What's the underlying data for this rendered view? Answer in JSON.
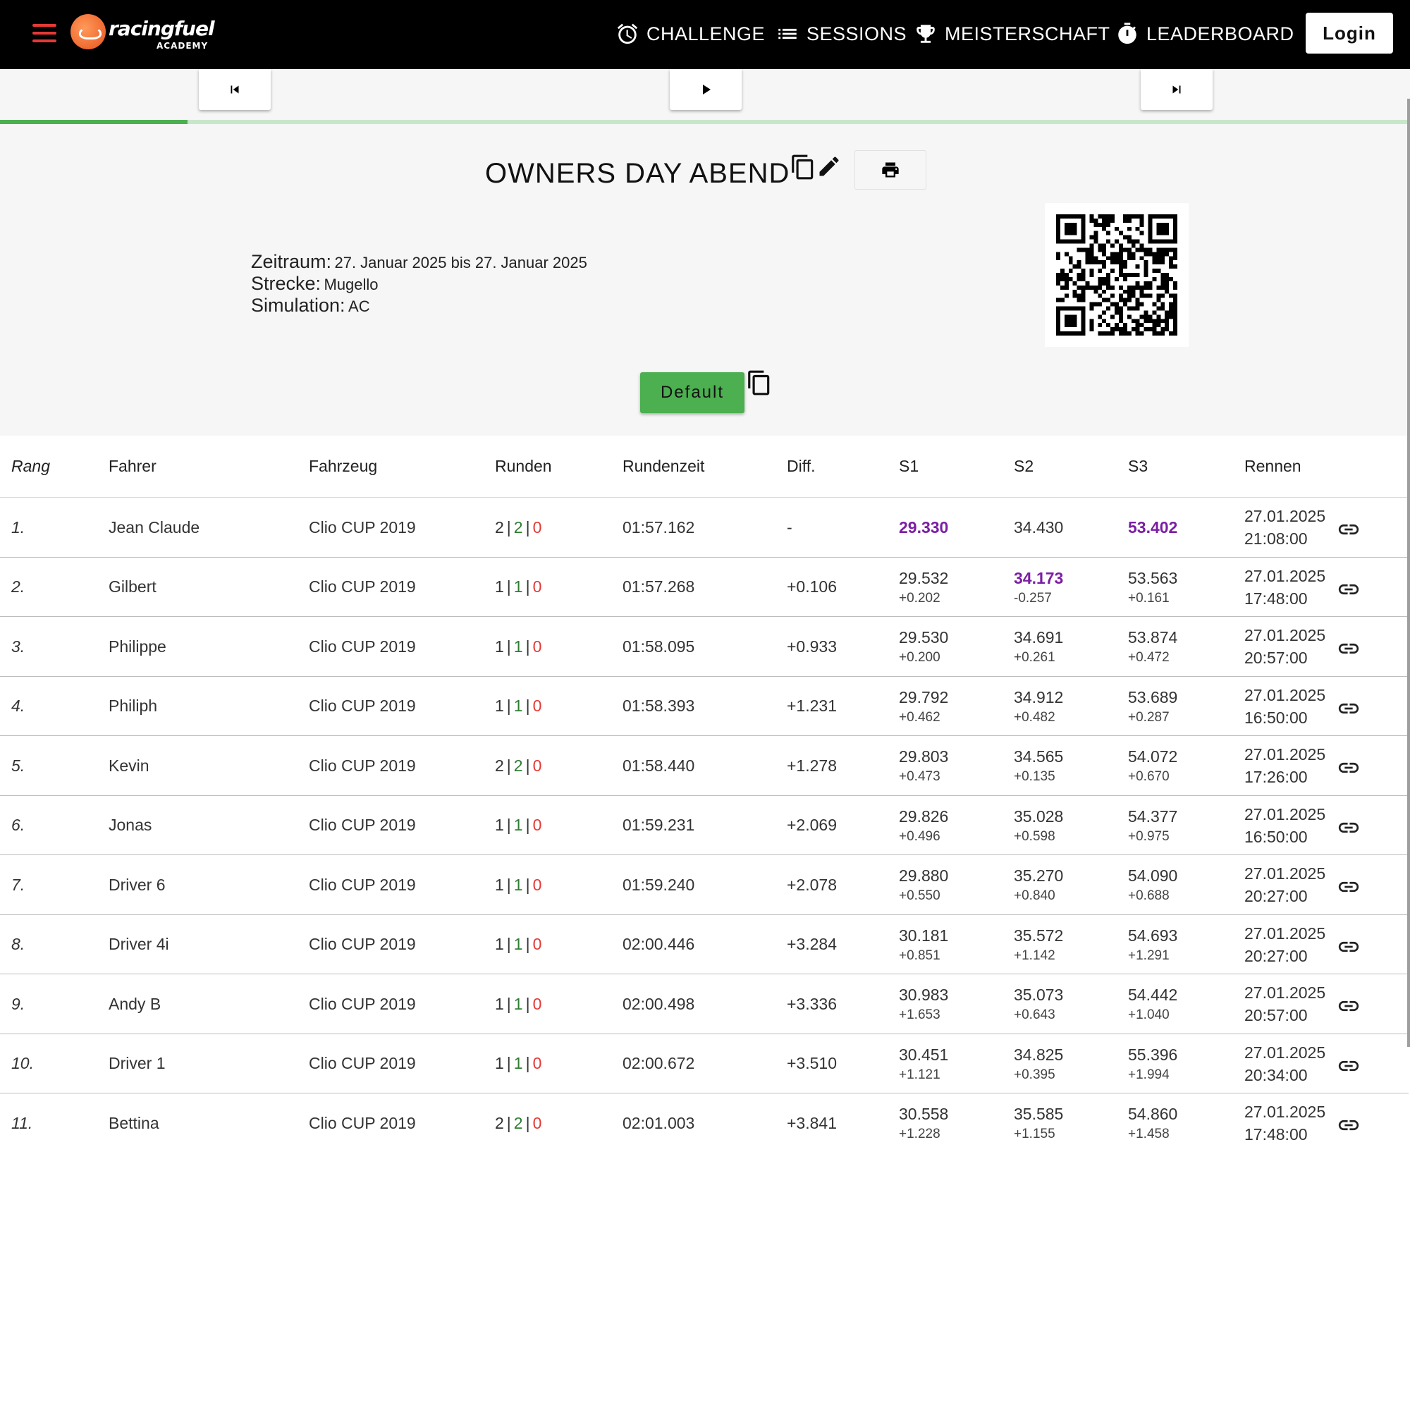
{
  "nav": {
    "brand": "racingfuel",
    "brand_sub": "ACADEMY",
    "items": [
      {
        "label": "CHALLENGE",
        "icon": "alarm-clock-icon"
      },
      {
        "label": "SESSIONS",
        "icon": "list-icon"
      },
      {
        "label": "MEISTERSCHAFT",
        "icon": "trophy-icon"
      },
      {
        "label": "LEADERBOARD",
        "icon": "stopwatch-icon"
      }
    ],
    "login_label": "Login"
  },
  "player": {
    "progress": 0.133,
    "buttons": [
      "skip-previous-icon",
      "play-icon",
      "skip-next-icon"
    ]
  },
  "event": {
    "title": "OWNERS DAY ABEND",
    "zeitraum_label": "Zeitraum:",
    "zeitraum_value": "27. Januar 2025 bis 27. Januar 2025",
    "strecke_label": "Strecke:",
    "strecke_value": "Mugello",
    "simulation_label": "Simulation:",
    "simulation_value": "AC",
    "default_label": "Default"
  },
  "colors": {
    "accent_green": "#4caf50",
    "best_purple": "#7b1fa2",
    "lap_green": "#2e7d32",
    "lap_red": "#e53935",
    "menu_red": "#e53935"
  },
  "table": {
    "headers": {
      "rang": "Rang",
      "fahrer": "Fahrer",
      "fahrzeug": "Fahrzeug",
      "runden": "Runden",
      "rundenzeit": "Rundenzeit",
      "diff": "Diff.",
      "s1": "S1",
      "s2": "S2",
      "s3": "S3",
      "rennen": "Rennen"
    },
    "rows": [
      {
        "rang": "1.",
        "fahrer": "Jean Claude",
        "fahrzeug": "Clio CUP 2019",
        "laps": [
          "2",
          "2",
          "0"
        ],
        "zeit": "01:57.162",
        "diff": "-",
        "s1": "29.330",
        "s1d": "",
        "s1best": true,
        "s2": "34.430",
        "s2d": "",
        "s2best": false,
        "s3": "53.402",
        "s3d": "",
        "s3best": true,
        "datum": "27.01.2025",
        "uhrzeit": "21:08:00"
      },
      {
        "rang": "2.",
        "fahrer": "Gilbert",
        "fahrzeug": "Clio CUP 2019",
        "laps": [
          "1",
          "1",
          "0"
        ],
        "zeit": "01:57.268",
        "diff": "+0.106",
        "s1": "29.532",
        "s1d": "+0.202",
        "s1best": false,
        "s2": "34.173",
        "s2d": "-0.257",
        "s2best": true,
        "s3": "53.563",
        "s3d": "+0.161",
        "s3best": false,
        "datum": "27.01.2025",
        "uhrzeit": "17:48:00"
      },
      {
        "rang": "3.",
        "fahrer": "Philippe",
        "fahrzeug": "Clio CUP 2019",
        "laps": [
          "1",
          "1",
          "0"
        ],
        "zeit": "01:58.095",
        "diff": "+0.933",
        "s1": "29.530",
        "s1d": "+0.200",
        "s1best": false,
        "s2": "34.691",
        "s2d": "+0.261",
        "s2best": false,
        "s3": "53.874",
        "s3d": "+0.472",
        "s3best": false,
        "datum": "27.01.2025",
        "uhrzeit": "20:57:00"
      },
      {
        "rang": "4.",
        "fahrer": "Philiph",
        "fahrzeug": "Clio CUP 2019",
        "laps": [
          "1",
          "1",
          "0"
        ],
        "zeit": "01:58.393",
        "diff": "+1.231",
        "s1": "29.792",
        "s1d": "+0.462",
        "s1best": false,
        "s2": "34.912",
        "s2d": "+0.482",
        "s2best": false,
        "s3": "53.689",
        "s3d": "+0.287",
        "s3best": false,
        "datum": "27.01.2025",
        "uhrzeit": "16:50:00"
      },
      {
        "rang": "5.",
        "fahrer": "Kevin",
        "fahrzeug": "Clio CUP 2019",
        "laps": [
          "2",
          "2",
          "0"
        ],
        "zeit": "01:58.440",
        "diff": "+1.278",
        "s1": "29.803",
        "s1d": "+0.473",
        "s1best": false,
        "s2": "34.565",
        "s2d": "+0.135",
        "s2best": false,
        "s3": "54.072",
        "s3d": "+0.670",
        "s3best": false,
        "datum": "27.01.2025",
        "uhrzeit": "17:26:00"
      },
      {
        "rang": "6.",
        "fahrer": "Jonas",
        "fahrzeug": "Clio CUP 2019",
        "laps": [
          "1",
          "1",
          "0"
        ],
        "zeit": "01:59.231",
        "diff": "+2.069",
        "s1": "29.826",
        "s1d": "+0.496",
        "s1best": false,
        "s2": "35.028",
        "s2d": "+0.598",
        "s2best": false,
        "s3": "54.377",
        "s3d": "+0.975",
        "s3best": false,
        "datum": "27.01.2025",
        "uhrzeit": "16:50:00"
      },
      {
        "rang": "7.",
        "fahrer": "Driver 6",
        "fahrzeug": "Clio CUP 2019",
        "laps": [
          "1",
          "1",
          "0"
        ],
        "zeit": "01:59.240",
        "diff": "+2.078",
        "s1": "29.880",
        "s1d": "+0.550",
        "s1best": false,
        "s2": "35.270",
        "s2d": "+0.840",
        "s2best": false,
        "s3": "54.090",
        "s3d": "+0.688",
        "s3best": false,
        "datum": "27.01.2025",
        "uhrzeit": "20:27:00"
      },
      {
        "rang": "8.",
        "fahrer": "Driver 4i",
        "fahrzeug": "Clio CUP 2019",
        "laps": [
          "1",
          "1",
          "0"
        ],
        "zeit": "02:00.446",
        "diff": "+3.284",
        "s1": "30.181",
        "s1d": "+0.851",
        "s1best": false,
        "s2": "35.572",
        "s2d": "+1.142",
        "s2best": false,
        "s3": "54.693",
        "s3d": "+1.291",
        "s3best": false,
        "datum": "27.01.2025",
        "uhrzeit": "20:27:00"
      },
      {
        "rang": "9.",
        "fahrer": "Andy B",
        "fahrzeug": "Clio CUP 2019",
        "laps": [
          "1",
          "1",
          "0"
        ],
        "zeit": "02:00.498",
        "diff": "+3.336",
        "s1": "30.983",
        "s1d": "+1.653",
        "s1best": false,
        "s2": "35.073",
        "s2d": "+0.643",
        "s2best": false,
        "s3": "54.442",
        "s3d": "+1.040",
        "s3best": false,
        "datum": "27.01.2025",
        "uhrzeit": "20:57:00"
      },
      {
        "rang": "10.",
        "fahrer": "Driver 1",
        "fahrzeug": "Clio CUP 2019",
        "laps": [
          "1",
          "1",
          "0"
        ],
        "zeit": "02:00.672",
        "diff": "+3.510",
        "s1": "30.451",
        "s1d": "+1.121",
        "s1best": false,
        "s2": "34.825",
        "s2d": "+0.395",
        "s2best": false,
        "s3": "55.396",
        "s3d": "+1.994",
        "s3best": false,
        "datum": "27.01.2025",
        "uhrzeit": "20:34:00"
      },
      {
        "rang": "11.",
        "fahrer": "Bettina",
        "fahrzeug": "Clio CUP 2019",
        "laps": [
          "2",
          "2",
          "0"
        ],
        "zeit": "02:01.003",
        "diff": "+3.841",
        "s1": "30.558",
        "s1d": "+1.228",
        "s1best": false,
        "s2": "35.585",
        "s2d": "+1.155",
        "s2best": false,
        "s3": "54.860",
        "s3d": "+1.458",
        "s3best": false,
        "datum": "27.01.2025",
        "uhrzeit": "17:48:00"
      }
    ]
  }
}
